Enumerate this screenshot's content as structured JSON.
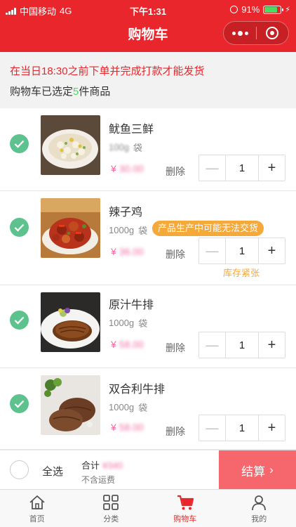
{
  "status_bar": {
    "carrier": "中国移动",
    "network": "4G",
    "time": "下午1:31",
    "battery": "91%"
  },
  "header": {
    "title": "购物车"
  },
  "notice": {
    "text": "在当日18:30之前下单并完成打款才能发货"
  },
  "selection": {
    "prefix": "购物车已选定",
    "count": "5",
    "suffix": "件商品"
  },
  "items": [
    {
      "name": "鱿鱼三鲜",
      "spec_value": "100g",
      "spec_unit": "袋",
      "currency": "¥",
      "price": "30.00",
      "delete_label": "删除",
      "quantity": "1",
      "minus": "—",
      "plus": "+"
    },
    {
      "name": "辣子鸡",
      "spec_value": "1000g",
      "spec_unit": "袋",
      "badge": "产品生产中可能无法交货",
      "currency": "¥",
      "price": "36.00",
      "delete_label": "删除",
      "quantity": "1",
      "minus": "—",
      "plus": "+",
      "stock_note": "库存紧张"
    },
    {
      "name": "原汁牛排",
      "spec_value": "1000g",
      "spec_unit": "袋",
      "currency": "¥",
      "price": "58.00",
      "delete_label": "删除",
      "quantity": "1",
      "minus": "—",
      "plus": "+"
    },
    {
      "name": "双合利牛排",
      "spec_value": "1000g",
      "spec_unit": "袋",
      "currency": "¥",
      "price": "58.00",
      "delete_label": "删除",
      "quantity": "1",
      "minus": "—",
      "plus": "+"
    }
  ],
  "footer": {
    "select_all": "全选",
    "total_label": "合计",
    "currency": "¥",
    "total_value": "340",
    "shipping_note": "不含运费",
    "checkout_label": "结算",
    "checkout_arrow": "›"
  },
  "tabbar": {
    "tabs": [
      {
        "label": "首页",
        "icon": "home-icon"
      },
      {
        "label": "分类",
        "icon": "category-icon"
      },
      {
        "label": "购物车",
        "icon": "cart-icon",
        "active": true
      },
      {
        "label": "我的",
        "icon": "profile-icon"
      }
    ]
  },
  "colors": {
    "brand_red": "#e8262b",
    "check_green": "#5ec28f",
    "price_pink": "#f06aa0",
    "badge_orange": "#f4a93a",
    "checkout_bg": "#f6676d"
  }
}
